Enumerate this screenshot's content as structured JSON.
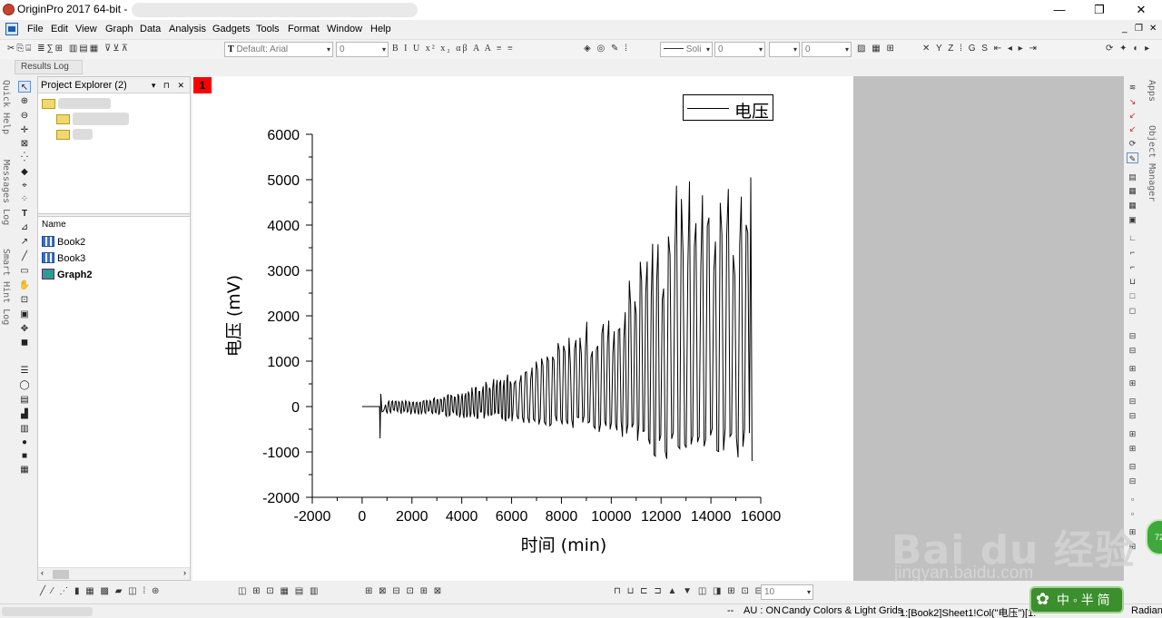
{
  "window": {
    "title": "OriginPro 2017 64-bit -",
    "controls": [
      "—",
      "❐",
      "✕"
    ]
  },
  "menu": {
    "items": [
      "File",
      "Edit",
      "View",
      "Graph",
      "Data",
      "Analysis",
      "Gadgets",
      "Tools",
      "Format",
      "Window",
      "Help"
    ],
    "mdi_controls": [
      "_",
      "❐",
      "✕"
    ]
  },
  "toolbar": {
    "font_value": "Default: Arial",
    "font_size_value": "0",
    "line_style_value": "Soli",
    "line_width_value": "0",
    "pattern_value": "0"
  },
  "results_log_label": "Results Log",
  "side_tabs": [
    "Quick Help",
    "Messages Log",
    "Smart Hint Log"
  ],
  "right_tabs": [
    "Apps",
    "Object Manager"
  ],
  "project_explorer": {
    "title": "Project Explorer (2)",
    "column_header": "Name",
    "items": [
      {
        "label": "Book2",
        "kind": "workbook"
      },
      {
        "label": "Book3",
        "kind": "workbook"
      },
      {
        "label": "Graph2",
        "kind": "graph"
      }
    ]
  },
  "graph": {
    "layer_number": "1",
    "legend_label": "电压"
  },
  "chart_data": {
    "type": "line",
    "title": "",
    "xlabel": "时间 (min)",
    "ylabel": "电压 (mV)",
    "xlim": [
      -2000,
      16000
    ],
    "ylim": [
      -2000,
      6000
    ],
    "x_ticks": [
      -2000,
      0,
      2000,
      4000,
      6000,
      8000,
      10000,
      12000,
      14000,
      16000
    ],
    "y_ticks": [
      -2000,
      -1000,
      0,
      1000,
      2000,
      3000,
      4000,
      5000,
      6000
    ],
    "legend": "top-right",
    "series": [
      {
        "name": "电压",
        "color": "#000000",
        "description_points": [
          [
            0,
            0
          ],
          [
            700,
            0
          ],
          [
            720,
            -700
          ],
          [
            750,
            280
          ],
          [
            800,
            -150
          ],
          [
            1000,
            150
          ],
          [
            2000,
            120
          ],
          [
            3000,
            200
          ],
          [
            4000,
            350
          ],
          [
            5000,
            600
          ],
          [
            6000,
            850
          ],
          [
            7000,
            1050
          ],
          [
            8000,
            1500
          ],
          [
            9000,
            1900
          ],
          [
            10000,
            2000
          ],
          [
            11000,
            3350
          ],
          [
            12000,
            4000
          ],
          [
            12400,
            5050
          ],
          [
            14000,
            5050
          ],
          [
            15600,
            5050
          ],
          [
            15650,
            -1200
          ]
        ],
        "min_envelope": [
          [
            1000,
            -150
          ],
          [
            3000,
            -200
          ],
          [
            5000,
            -300
          ],
          [
            7000,
            -400
          ],
          [
            9000,
            -500
          ],
          [
            10000,
            -700
          ],
          [
            11000,
            -900
          ],
          [
            12000,
            -1200
          ],
          [
            14000,
            -1000
          ],
          [
            15600,
            -1200
          ]
        ]
      }
    ]
  },
  "bottom_toolbar": {
    "zoom_value": "10"
  },
  "status": {
    "left": "--",
    "au": "AU : ON",
    "theme": "Candy Colors & Light Grids",
    "selection": "1:[Book2]Sheet1!Col(\"电压\")[1:",
    "angle": "Radian"
  },
  "watermark": {
    "logo": "Bai du 经验",
    "url": "jingyan.baidu.com",
    "badge": "中 ◦ 半 简",
    "circle": "72"
  }
}
